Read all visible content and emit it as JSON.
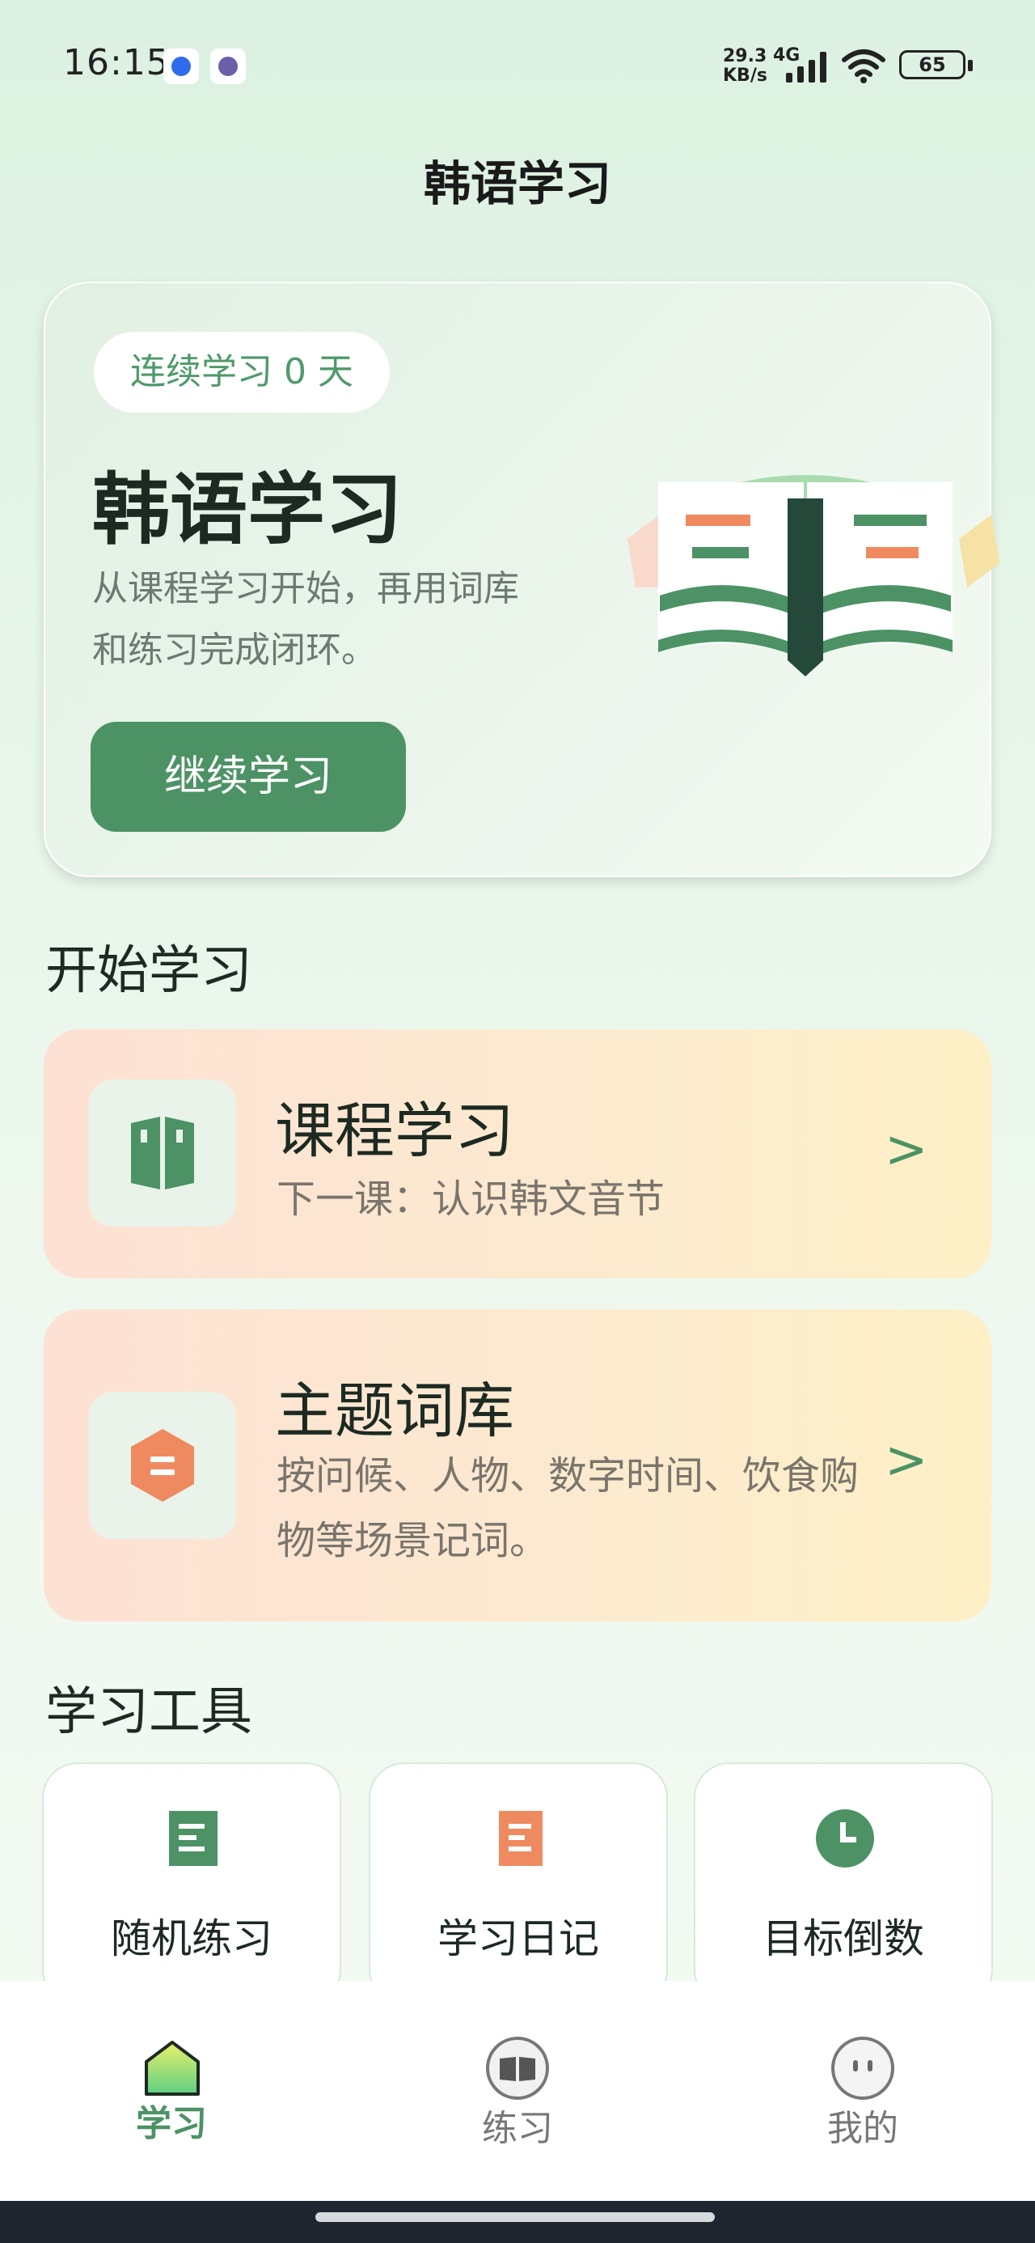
{
  "status_bar": {
    "time": "16:15",
    "net_speed_value": "29.3",
    "net_speed_unit": "KB/s",
    "net_type": "4G",
    "battery": "65"
  },
  "header": {
    "title": "韩语学习"
  },
  "hero": {
    "streak_label": "连续学习 0 天",
    "title": "韩语学习",
    "desc_line1": "从课程学习开始，再用词库",
    "desc_line2": "和练习完成闭环。",
    "button_label": "继续学习"
  },
  "start_section": {
    "title": "开始学习",
    "cards": [
      {
        "title": "课程学习",
        "subtitle": "下一课：认识韩文音节",
        "arrow": ">",
        "icon": "book-icon"
      },
      {
        "title": "主题词库",
        "subtitle_line1": "按问候、人物、数字时间、饮食购",
        "subtitle_line2": "物等场景记词。",
        "arrow": ">",
        "icon": "hexagon-list-icon"
      }
    ]
  },
  "tools_section": {
    "title": "学习工具",
    "items": [
      {
        "label": "随机练习",
        "icon": "document-icon",
        "color": "#4c9265"
      },
      {
        "label": "学习日记",
        "icon": "document-icon",
        "color": "#ef8a60"
      },
      {
        "label": "目标倒数",
        "icon": "clock-icon",
        "color": "#4c9265"
      }
    ]
  },
  "tab_bar": {
    "tabs": [
      {
        "label": "学习",
        "icon": "home-icon",
        "active": true
      },
      {
        "label": "练习",
        "icon": "open-book-icon",
        "active": false
      },
      {
        "label": "我的",
        "icon": "profile-icon",
        "active": false
      }
    ]
  },
  "colors": {
    "accent": "#4c9265",
    "orange": "#ef8a60",
    "pill_text": "#4e9a6a"
  }
}
